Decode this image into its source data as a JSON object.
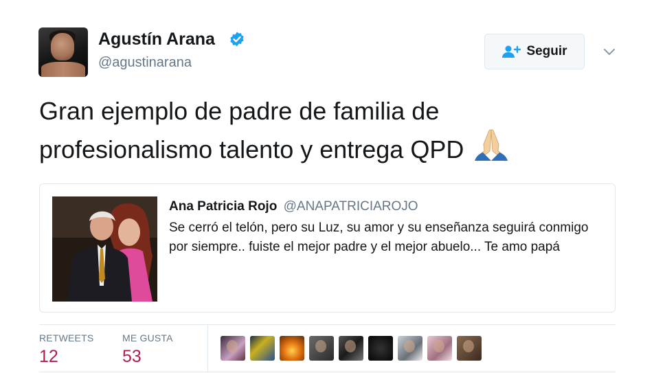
{
  "author": {
    "name": "Agustín Arana",
    "handle": "@agustinarana",
    "verified_color": "#1da1f2"
  },
  "follow_button": {
    "label": "Seguir",
    "icon": "add-user-icon"
  },
  "menu": {
    "icon": "chevron-down-icon"
  },
  "tweet": {
    "text": "Gran ejemplo de padre de familia de profesionalismo talento y entrega QPD",
    "emoji": "folded-hands-icon"
  },
  "quoted_tweet": {
    "author_name": "Ana Patricia Rojo",
    "author_handle": "@ANAPATRICIAROJO",
    "text": "Se cerró el telón, pero su Luz, su amor y su enseñanza seguirá conmigo por siempre.. fuiste el mejor padre y el mejor abuelo... Te amo papá"
  },
  "stats": {
    "retweets_label": "RETWEETS",
    "retweets_value": "12",
    "likes_label": "ME GUSTA",
    "likes_value": "53",
    "value_color": "#b01c4f"
  },
  "likers": [
    {
      "bg": "linear-gradient(135deg,#3a2a3a,#c9a0c0 60%,#5a3040)"
    },
    {
      "bg": "linear-gradient(135deg,#1a2a4a,#c8b020 40%,#2a5090)"
    },
    {
      "bg": "radial-gradient(circle at 50% 60%,#ffd04a,#e07010 45%,#5a2a08)"
    },
    {
      "bg": "linear-gradient(135deg,#6a6a6a,#2a2a2a)"
    },
    {
      "bg": "linear-gradient(135deg,#555,#1a1a1a 50%,#777)"
    },
    {
      "bg": "radial-gradient(circle at 50% 50%,#333,#050505)"
    },
    {
      "bg": "linear-gradient(135deg,#c8d0d8,#6a7078 60%,#f0f0f0)"
    },
    {
      "bg": "linear-gradient(135deg,#e8c8d0,#a07080 60%,#f0e0e8)"
    },
    {
      "bg": "linear-gradient(135deg,#8a6a50,#3a2a20)"
    }
  ]
}
